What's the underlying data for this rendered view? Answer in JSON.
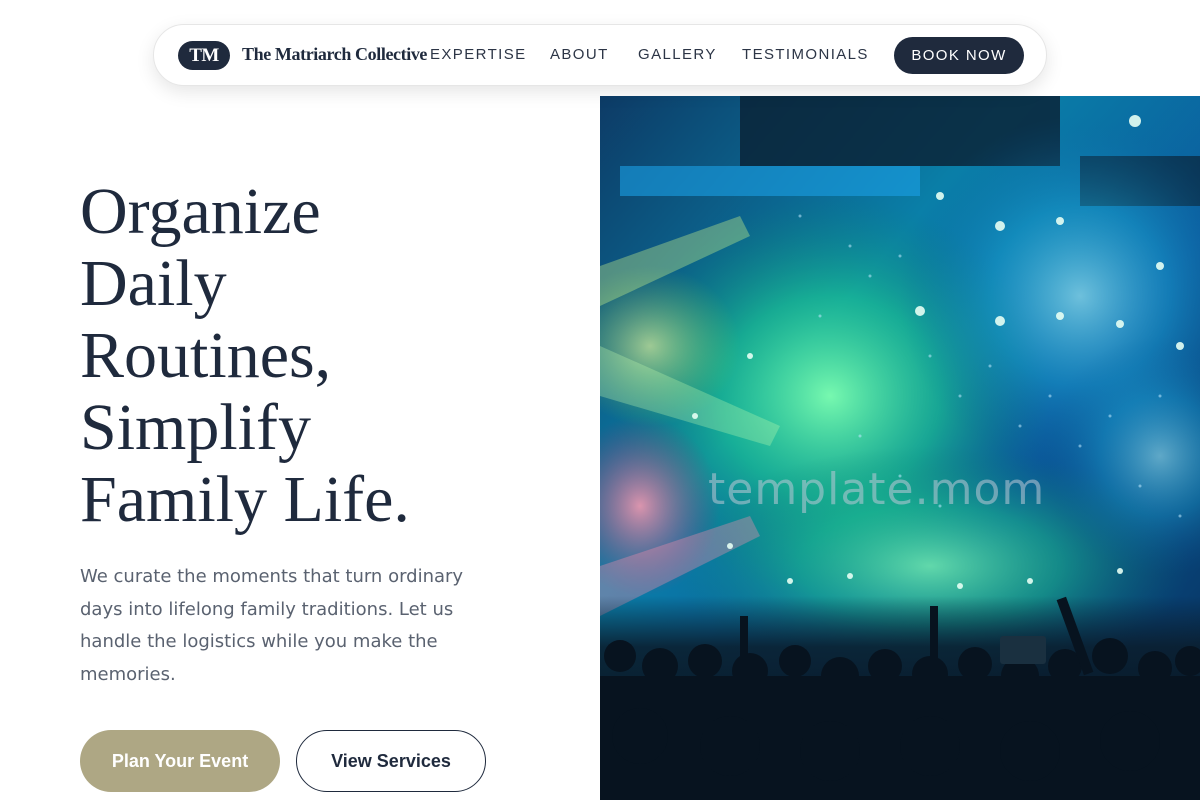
{
  "nav": {
    "logo_text": "TM",
    "brand_name": "The Matriarch Collective",
    "links": [
      "EXPERTISE",
      "ABOUT",
      "GALLERY",
      "TESTIMONIALS"
    ],
    "cta_label": "BOOK NOW"
  },
  "hero": {
    "headline_lines": [
      "Organize",
      "Daily",
      "Routines,",
      "Simplify",
      "Family Life."
    ],
    "subtext": "We curate the moments that turn ordinary days into lifelong family traditions. Let us handle the logistics while you make the memories.",
    "primary_button": "Plan Your Event",
    "secondary_button": "View Services",
    "image": {
      "subject": "concert crowd with confetti and green/blue stage lights",
      "watermark": "template.mom"
    }
  },
  "colors": {
    "navy": "#1f2a3d",
    "gold": "#aea784",
    "body_text": "#5a6270"
  }
}
